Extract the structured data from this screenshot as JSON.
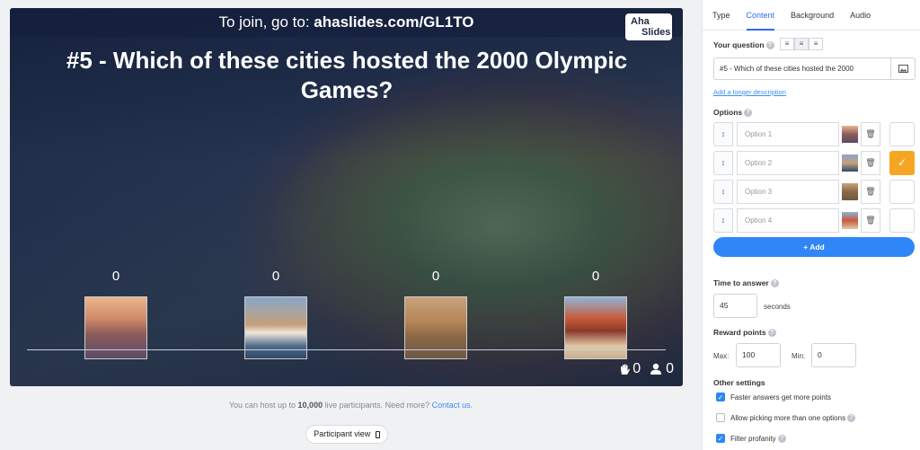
{
  "slide": {
    "join_prefix": "To join, go to: ",
    "join_url": "ahaslides.com/GL1TO",
    "logo_line1": "Aha",
    "logo_line2": "Slides",
    "question": "#5 - Which of these cities hosted the 2000 Olympic Games?",
    "answers": [
      {
        "count": "0",
        "image": "moscow-photo"
      },
      {
        "count": "0",
        "image": "sydney-opera-house-photo"
      },
      {
        "count": "0",
        "image": "athens-acropolis-photo"
      },
      {
        "count": "0",
        "image": "beijing-pagoda-photo"
      }
    ],
    "reactions_count": "0",
    "participants_count": "0"
  },
  "footer": {
    "host_note_prefix": "You can host up to ",
    "host_note_bold": "10,000",
    "host_note_mid": " live participants. Need more? ",
    "contact_link": "Contact us",
    "host_note_end": ".",
    "participant_view": "Participant view"
  },
  "panel": {
    "tabs": [
      "Type",
      "Content",
      "Background",
      "Audio"
    ],
    "active_tab": "Content",
    "your_question_label": "Your question",
    "question_value": "#5 - Which of these cities hosted the 2000",
    "longer_description": "Add a longer description",
    "options_label": "Options",
    "options": [
      {
        "placeholder": "Option 1",
        "correct": false
      },
      {
        "placeholder": "Option 2",
        "correct": true
      },
      {
        "placeholder": "Option 3",
        "correct": false
      },
      {
        "placeholder": "Option 4",
        "correct": false
      }
    ],
    "add_label": "+ Add",
    "time_label": "Time to answer",
    "time_value": "45",
    "time_unit": "seconds",
    "reward_label": "Reward points",
    "max_label": "Max:",
    "max_value": "100",
    "min_label": "Min:",
    "min_value": "0",
    "other_label": "Other settings",
    "settings": [
      {
        "label": "Faster answers get more points",
        "checked": true,
        "help": false
      },
      {
        "label": "Allow picking more than one options",
        "checked": false,
        "help": true
      },
      {
        "label": "Filter profanity",
        "checked": true,
        "help": true
      }
    ]
  },
  "colors": {
    "accent": "#2f6bf3",
    "add_button": "#2f86f6",
    "correct": "#f5a623"
  }
}
